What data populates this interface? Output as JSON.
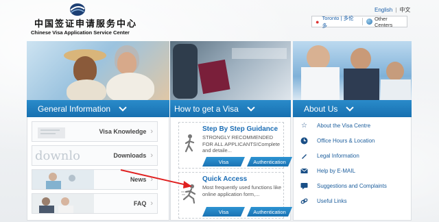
{
  "header": {
    "logo_cn": "中国签证申请服务中心",
    "logo_en": "Chinese Visa Application Service Center",
    "lang_en": "English",
    "lang_sep": "|",
    "lang_cn": "中文",
    "location_city": "Toronto | 多伦多",
    "other_centers": "Other Centers"
  },
  "columns": {
    "general": {
      "tab_label": "General Information",
      "items": [
        {
          "label": "Visa Knowledge"
        },
        {
          "label": "Downloads",
          "thumb_text": "downlo"
        },
        {
          "label": "News"
        },
        {
          "label": "FAQ"
        }
      ]
    },
    "how": {
      "tab_label": "How to get a Visa",
      "cards": [
        {
          "title": "Step By Step Guidance",
          "desc": "STRONGLY RECOMMENDED FOR ALL APPLICANTS!Complete and detaile...",
          "btn_visa": "Visa",
          "btn_auth": "Authentication"
        },
        {
          "title": "Quick Access",
          "desc": "Most frequently used functions like online application form,...",
          "btn_visa": "Visa",
          "btn_auth": "Authentication"
        }
      ]
    },
    "about": {
      "tab_label": "About Us",
      "items": [
        {
          "label": "About the Visa Centre",
          "icon": "star-icon"
        },
        {
          "label": "Office Hours & Location",
          "icon": "clock-icon"
        },
        {
          "label": "Legal Information",
          "icon": "pen-icon"
        },
        {
          "label": "Help by E-MAIL",
          "icon": "mail-icon"
        },
        {
          "label": "Suggestions and Complaints",
          "icon": "chat-icon"
        },
        {
          "label": "Useful Links",
          "icon": "link-icon"
        }
      ]
    }
  },
  "colors": {
    "tab_blue": "#1f7fc0",
    "link_blue": "#1b6db5",
    "annotation_red": "#e02020"
  }
}
